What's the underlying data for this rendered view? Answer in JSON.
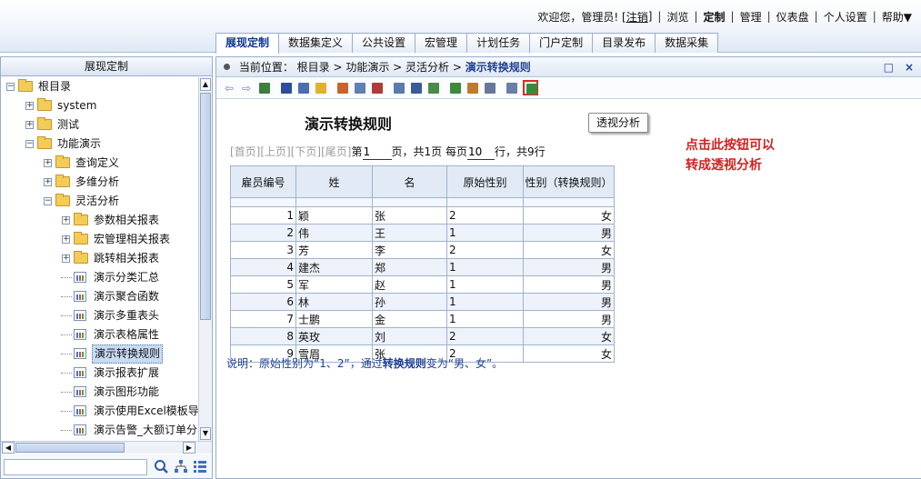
{
  "user_nav": {
    "welcome": "欢迎您，管理员! [",
    "logout": "注销",
    "close_bracket": "]",
    "items": [
      "浏览",
      "定制",
      "管理",
      "仪表盘",
      "个人设置",
      "帮助▼"
    ]
  },
  "main_tabs": [
    "展现定制",
    "数据集定义",
    "公共设置",
    "宏管理",
    "计划任务",
    "门户定制",
    "目录发布",
    "数据采集"
  ],
  "left_panel": {
    "title": "展现定制",
    "tree": [
      {
        "label": "根目录",
        "level": 0,
        "type": "folder",
        "expander": "−"
      },
      {
        "label": "system",
        "level": 1,
        "type": "folder",
        "expander": "+"
      },
      {
        "label": "测试",
        "level": 1,
        "type": "folder",
        "expander": "+"
      },
      {
        "label": "功能演示",
        "level": 1,
        "type": "folder",
        "expander": "−"
      },
      {
        "label": "查询定义",
        "level": 2,
        "type": "folder",
        "expander": "+"
      },
      {
        "label": "多维分析",
        "level": 2,
        "type": "folder",
        "expander": "+"
      },
      {
        "label": "灵活分析",
        "level": 2,
        "type": "folder",
        "expander": "−"
      },
      {
        "label": "参数相关报表",
        "level": 3,
        "type": "folder",
        "expander": "+"
      },
      {
        "label": "宏管理相关报表",
        "level": 3,
        "type": "folder",
        "expander": "+"
      },
      {
        "label": "跳转相关报表",
        "level": 3,
        "type": "folder",
        "expander": "+"
      },
      {
        "label": "演示分类汇总",
        "level": 3,
        "type": "report",
        "expander": ""
      },
      {
        "label": "演示聚合函数",
        "level": 3,
        "type": "report",
        "expander": ""
      },
      {
        "label": "演示多重表头",
        "level": 3,
        "type": "report",
        "expander": ""
      },
      {
        "label": "演示表格属性",
        "level": 3,
        "type": "report",
        "expander": ""
      },
      {
        "label": "演示转换规则",
        "level": 3,
        "type": "report",
        "expander": "",
        "selected": true
      },
      {
        "label": "演示报表扩展",
        "level": 3,
        "type": "report",
        "expander": ""
      },
      {
        "label": "演示图形功能",
        "level": 3,
        "type": "report",
        "expander": ""
      },
      {
        "label": "演示使用Excel模板导",
        "level": 3,
        "type": "report",
        "expander": ""
      },
      {
        "label": "演示告警_大额订单分",
        "level": 3,
        "type": "report",
        "expander": ""
      }
    ]
  },
  "breadcrumb": {
    "prefix": "当前位置：",
    "path": "根目录 > 功能演示 > 灵活分析 > ",
    "current": "演示转换规则",
    "btn_max": "□",
    "btn_close": "×"
  },
  "tooltip": "透视分析",
  "report": {
    "title": "演示转换规则",
    "pager": {
      "first": "[首页]",
      "prev": "[上页]",
      "next": "[下页]",
      "last": "[尾页]",
      "page_prefix": "第",
      "page_value": "1",
      "page_suffix": "页，共1页 每页",
      "size_value": "10",
      "size_suffix": "行，共9行"
    },
    "columns": [
      "雇员编号",
      "姓",
      "名",
      "原始性别",
      "性别（转换规则）"
    ],
    "rows": [
      [
        1,
        "颖",
        "张",
        "2",
        "女"
      ],
      [
        2,
        "伟",
        "王",
        "1",
        "男"
      ],
      [
        3,
        "芳",
        "李",
        "2",
        "女"
      ],
      [
        4,
        "建杰",
        "郑",
        "1",
        "男"
      ],
      [
        5,
        "军",
        "赵",
        "1",
        "男"
      ],
      [
        6,
        "林",
        "孙",
        "1",
        "男"
      ],
      [
        7,
        "士鹏",
        "金",
        "1",
        "男"
      ],
      [
        8,
        "英玫",
        "刘",
        "2",
        "女"
      ],
      [
        9,
        "雪眉",
        "张",
        "2",
        "女"
      ]
    ],
    "note": {
      "part1": "说明：原始性别为“1、2”，通过",
      "bold": "转换规则",
      "part2": "变为“男、女”。"
    }
  },
  "annotation": {
    "line1": "点击此按钮可以",
    "line2": "转成透视分析"
  },
  "colors": {
    "accent": "#1d3f93",
    "annotation_red": "#d41f1f",
    "highlight_border": "#d92a2a"
  }
}
